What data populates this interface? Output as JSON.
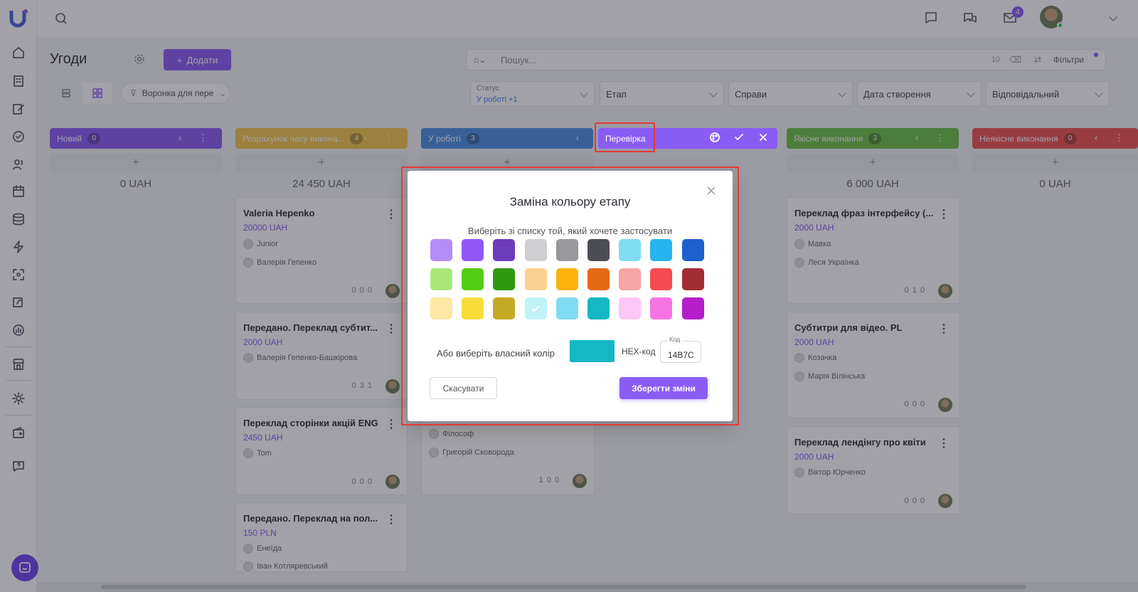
{
  "topbar": {
    "mail_badge": "4"
  },
  "header": {
    "title": "Угоди",
    "add_label": "Додати",
    "funnel_label": "Воронка для пере"
  },
  "search": {
    "placeholder": "Пошук...",
    "count": "10",
    "filters_label": "Фільтри"
  },
  "filters": [
    {
      "label": "Статус",
      "value": "У роботі +1"
    },
    {
      "label": "Етап"
    },
    {
      "label": "Справи"
    },
    {
      "label": "Дата створення"
    },
    {
      "label": "Відповідальний"
    }
  ],
  "columns": [
    {
      "name": "Новий",
      "count": "0",
      "color": "#8a5cf6",
      "sum": "0 UAH"
    },
    {
      "name": "Розрахунок часу викона...",
      "count": "4",
      "color": "#f5c64a",
      "sum": "24 450 UAH"
    },
    {
      "name": "У роботі",
      "count": "3",
      "color": "#4a90e2",
      "sum": ""
    },
    {
      "name": "Перевірка",
      "count": "",
      "color": "#8a5cf6",
      "sum": ""
    },
    {
      "name": "Якісне виконання",
      "count": "3",
      "color": "#6bc145",
      "sum": "6 000 UAH"
    },
    {
      "name": "Неякісне виконання",
      "count": "0",
      "color": "#f0524f",
      "sum": "0 UAH"
    }
  ],
  "cards": {
    "c1": {
      "title": "Valeria Hepenko",
      "price": "20000 UAH",
      "tag1": "Junior",
      "tag2": "Валерія Гепенко",
      "meta": "0   0   0"
    },
    "c2": {
      "title": "Передано. Переклад субтит...",
      "price": "2000 UAH",
      "tag1": "Валерія Гепенко-Башкірова",
      "meta": "0   3   1"
    },
    "c3": {
      "title": "Переклад сторінки акцій ENG",
      "price": "2450 UAH",
      "tag1": "Tom",
      "meta": "0   0   0"
    },
    "c4": {
      "title": "Передано. Переклад на пол...",
      "price": "150 PLN",
      "tag1": "Енеїда",
      "tag2": "Іван Котляревський"
    },
    "c5": {
      "tag1": "Філософ",
      "tag2": "Григорій Сковорода",
      "meta": "1   0   0"
    },
    "c6": {
      "title": "Переклад фраз інтерфейсу (...",
      "price": "2000 UAH",
      "tag1": "Мавка",
      "tag2": "Леся Українка",
      "meta": "0   1   0"
    },
    "c7": {
      "title": "Субтитри для відео. PL",
      "price": "2000 UAH",
      "tag1": "Козачка",
      "tag2": "Марія Вілінська",
      "meta": "0   0   0"
    },
    "c8": {
      "title": "Переклад лендінгу про квіти",
      "price": "2000 UAH",
      "tag1": "Віктор Юрченко",
      "meta": "0   0   0"
    }
  },
  "modal": {
    "title": "Заміна кольору етапу",
    "subtitle": "Виберіть зі списку той, який хочете застосувати",
    "custom_label": "Або виберіть власний колір",
    "hex_label": "HEX-код",
    "hex_caption": "Код",
    "hex_value": "14B7C",
    "custom_color": "#14b7c3",
    "cancel_label": "Скасувати",
    "save_label": "Зберегти зміни",
    "selected_index": 21,
    "swatches": [
      "#b48cf7",
      "#9257f7",
      "#6d3bbd",
      "#cfcfd1",
      "#98989c",
      "#4d4d55",
      "#7fdcf2",
      "#25b4ef",
      "#1c61cc",
      "#a8e876",
      "#53cd12",
      "#2e9a0e",
      "#fcd08e",
      "#fbb30b",
      "#e56812",
      "#f8a3a4",
      "#f44c4f",
      "#a42d33",
      "#fde8a4",
      "#f9dc3a",
      "#c5a924",
      "#bff3f8",
      "#7fdbf3",
      "#14b7c3",
      "#fcc6f6",
      "#f673e3",
      "#b51ec8"
    ]
  }
}
